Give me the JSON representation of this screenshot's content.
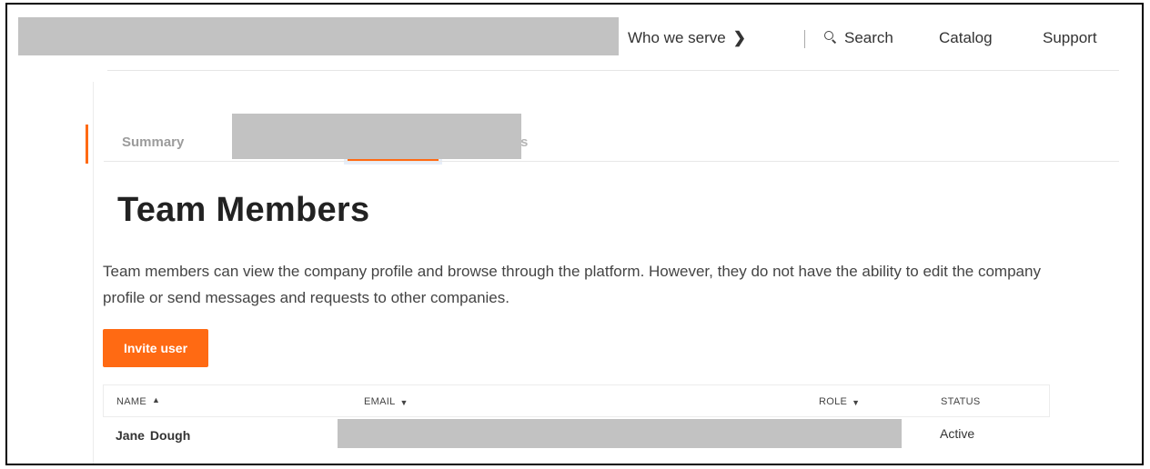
{
  "header": {
    "nav": {
      "who_we_serve": "Who we serve",
      "search": "Search",
      "catalog": "Catalog",
      "support": "Support"
    }
  },
  "tabs": {
    "summary": "Summary",
    "partial_tab_tail": "s"
  },
  "page": {
    "title": "Team Members",
    "description": "Team members can view the company profile and browse through the platform. However, they do not have the ability to edit the company profile or send messages and requests to other companies.",
    "invite_button": "Invite user"
  },
  "table": {
    "columns": {
      "name": "NAME",
      "email": "EMAIL",
      "role": "ROLE",
      "status": "STATUS"
    },
    "rows": [
      {
        "first_name": "Jane",
        "last_name": "Dough",
        "status": "Active"
      }
    ]
  },
  "colors": {
    "accent": "#ff6a13",
    "redaction": "#c2c2c2"
  }
}
